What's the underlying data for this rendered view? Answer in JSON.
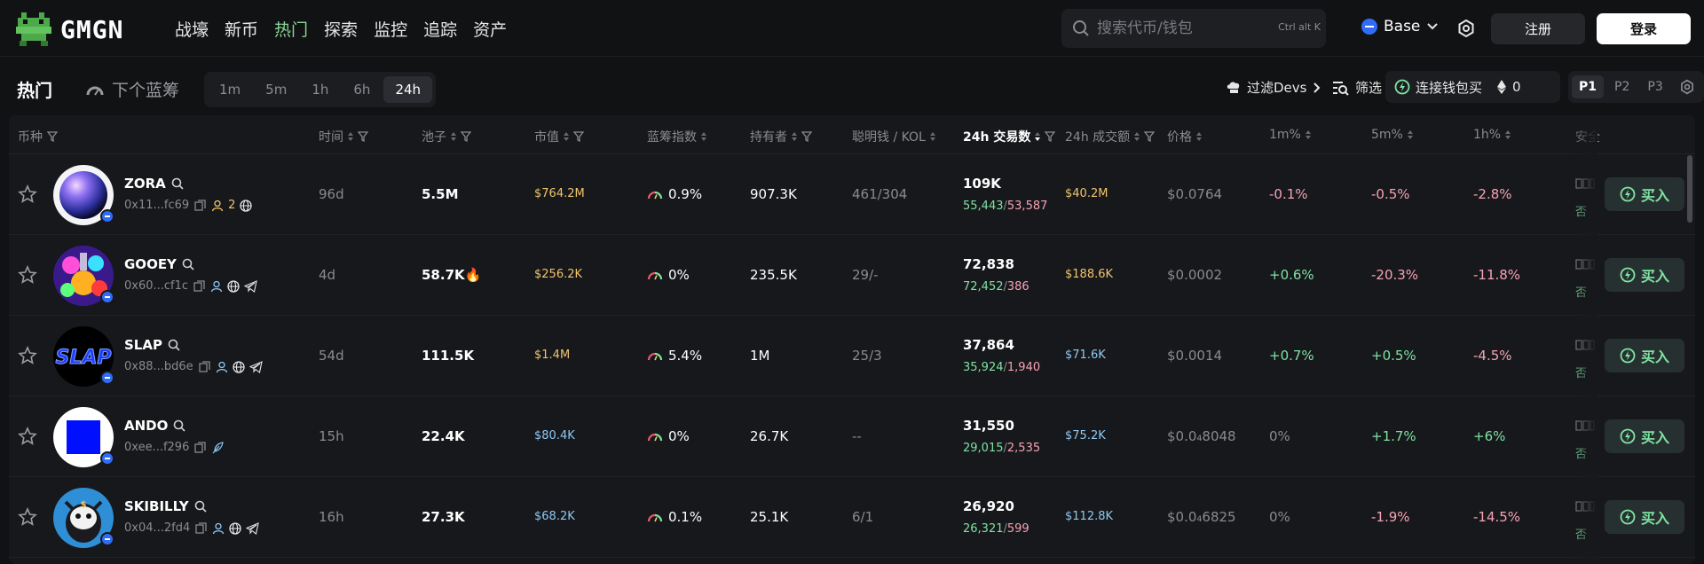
{
  "header": {
    "logo_text": "GMGN",
    "nav": [
      "战壕",
      "新币",
      "热门",
      "探索",
      "监控",
      "追踪",
      "资产"
    ],
    "nav_active": "热门",
    "search_placeholder": "搜索代币/钱包",
    "search_shortcut": "Ctrl alt K",
    "chain": "Base",
    "register": "注册",
    "login": "登录"
  },
  "subbar": {
    "tab_hot": "热门",
    "tab_next": "下个蓝筹",
    "time_options": [
      "1m",
      "5m",
      "1h",
      "6h",
      "24h"
    ],
    "time_active": "24h",
    "filter_devs": "过滤Devs",
    "filter": "筛选",
    "connect_wallet": "连接钱包买",
    "wallet_amount": "0",
    "pages": [
      "P1",
      "P2",
      "P3"
    ],
    "page_active": "P1"
  },
  "columns": {
    "coin": "币种",
    "time": "时间",
    "pool": "池子",
    "mcap": "市值",
    "bluechip": "蓝筹指数",
    "holders": "持有者",
    "smart": "聪明钱 / KOL",
    "tx24": "24h 交易数",
    "vol24": "24h 成交额",
    "price": "价格",
    "m1": "1m%",
    "m5": "5m%",
    "h1": "1h%",
    "safety": "安全"
  },
  "rows": [
    {
      "name": "ZORA",
      "addr": "0x11...fc69",
      "holders_icon_count": "2",
      "time": "96d",
      "pool": "5.5M",
      "pool_fire": "",
      "mcap": "$764.2M",
      "mcap_color": "yellow",
      "bluechip": "0.9%",
      "holders": "907.3K",
      "smart": "461/304",
      "tx": "109K",
      "tx_buy": "55,443",
      "tx_sell": "53,587",
      "vol": "$40.2M",
      "vol_color": "yellow",
      "price": "$0.0764",
      "m1": "-0.1%",
      "m5": "-0.5%",
      "h1": "-2.8%",
      "safe_no": "否"
    },
    {
      "name": "GOOEY",
      "addr": "0x60...cf1c",
      "holders_icon_count": "",
      "time": "4d",
      "pool": "58.7K",
      "pool_fire": "🔥",
      "mcap": "$256.2K",
      "mcap_color": "yellow",
      "bluechip": "0%",
      "holders": "235.5K",
      "smart": "29/-",
      "tx": "72,838",
      "tx_buy": "72,452",
      "tx_sell": "386",
      "vol": "$188.6K",
      "vol_color": "yellow",
      "price": "$0.0002",
      "m1": "+0.6%",
      "m5": "-20.3%",
      "h1": "-11.8%",
      "safe_no": "否"
    },
    {
      "name": "SLAP",
      "addr": "0x88...bd6e",
      "holders_icon_count": "",
      "time": "54d",
      "pool": "111.5K",
      "pool_fire": "",
      "mcap": "$1.4M",
      "mcap_color": "yellow",
      "bluechip": "5.4%",
      "holders": "1M",
      "smart": "25/3",
      "tx": "37,864",
      "tx_buy": "35,924",
      "tx_sell": "1,940",
      "vol": "$71.6K",
      "vol_color": "blue",
      "price": "$0.0014",
      "m1": "+0.7%",
      "m5": "+0.5%",
      "h1": "-4.5%",
      "safe_no": "否"
    },
    {
      "name": "ANDO",
      "addr": "0xee...f296",
      "holders_icon_count": "",
      "time": "15h",
      "pool": "22.4K",
      "pool_fire": "",
      "mcap": "$80.4K",
      "mcap_color": "blue",
      "bluechip": "0%",
      "holders": "26.7K",
      "smart": "--",
      "tx": "31,550",
      "tx_buy": "29,015",
      "tx_sell": "2,535",
      "vol": "$75.2K",
      "vol_color": "blue",
      "price": "$0.0₄8048",
      "m1": "0%",
      "m5": "+1.7%",
      "h1": "+6%",
      "safe_no": "否"
    },
    {
      "name": "SKIBILLY",
      "addr": "0x04...2fd4",
      "holders_icon_count": "",
      "time": "16h",
      "pool": "27.3K",
      "pool_fire": "",
      "mcap": "$68.2K",
      "mcap_color": "blue",
      "bluechip": "0.1%",
      "holders": "25.1K",
      "smart": "6/1",
      "tx": "26,920",
      "tx_buy": "26,321",
      "tx_sell": "599",
      "vol": "$112.8K",
      "vol_color": "blue",
      "price": "$0.0₄6825",
      "m1": "0%",
      "m5": "-1.9%",
      "h1": "-14.5%",
      "safe_no": "否"
    }
  ],
  "buy_label": "买入",
  "colors": {
    "accent_green": "#88d693",
    "positive": "#7fe3a3",
    "negative": "#f6a3b3",
    "yellow": "#f2c56b",
    "blue": "#8ec9f5",
    "base_blue": "#2f6df6"
  }
}
